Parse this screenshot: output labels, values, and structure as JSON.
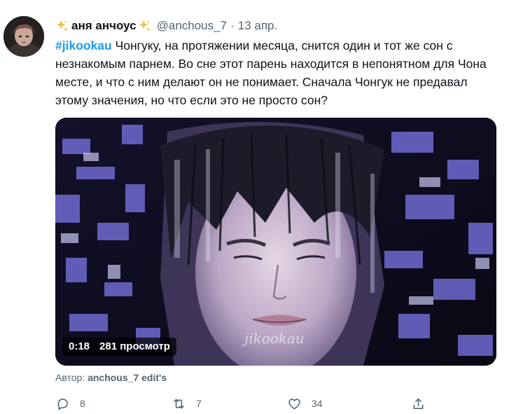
{
  "tweet": {
    "author": {
      "display_name": "аня анчоус",
      "handle": "@anchous_7",
      "avatar_icon": "avatar-photo",
      "name_decoration_icon": "sparkles-icon"
    },
    "separator": "·",
    "date": "13 апр.",
    "hashtag": "#jikookau",
    "text": " Чонгуку, на протяжении месяца, снится один и тот же сон с незнакомым парнем. Во сне этот парень находится в непонятном для Чона месте, и что с ним делают он не понимает. Сначала Чонгук не предавал этому значения, но что если это не просто сон?",
    "media": {
      "type": "video",
      "duration": "0:18",
      "views": "281 просмотр"
    },
    "caption": {
      "prefix": "Автор:",
      "author": "anchous_7 edit's"
    },
    "actions": {
      "reply": {
        "icon": "reply-icon",
        "count": "8"
      },
      "retweet": {
        "icon": "retweet-icon",
        "count": "7"
      },
      "like": {
        "icon": "heart-icon",
        "count": "34"
      },
      "share": {
        "icon": "share-icon"
      }
    }
  }
}
